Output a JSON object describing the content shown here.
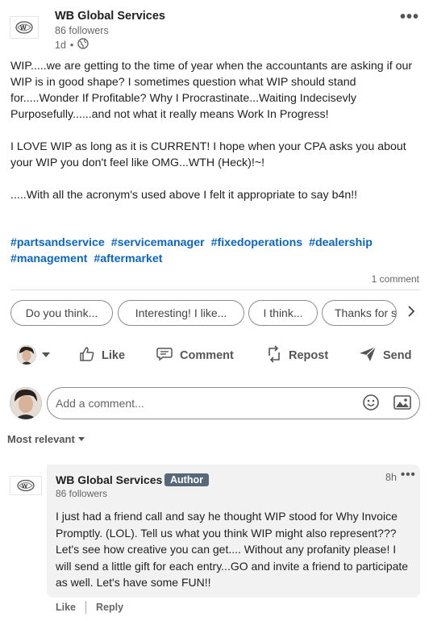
{
  "post": {
    "author": "WB Global Services",
    "followers": "86 followers",
    "time": "1d",
    "dot": "•",
    "more": "•••",
    "paragraphs": [
      "WIP.....we are getting to the time of year when the accountants are asking if our WIP is in good shape? I sometimes question what WIP should stand for.....Wonder If Profitable? Why I Procrastinate...Waiting Indecisevly Purposefully......and not what it really means Work In Progress!",
      "I LOVE WIP as long as it is CURRENT! I hope when your CPA asks you about your WIP you don't feel like OMG...WTH (Heck)!~!",
      ".....With all the acronym's used above I felt it appropriate to say b4n!!"
    ],
    "hashtags": [
      "#partsandservice",
      "#servicemanager",
      "#fixedoperations",
      "#dealership",
      "#management",
      "#aftermarket"
    ],
    "comment_count": "1 comment"
  },
  "suggestions": [
    "Do you think...",
    "Interesting! I like...",
    "I think...",
    "Thanks for s"
  ],
  "actions": {
    "like": "Like",
    "comment": "Comment",
    "repost": "Repost",
    "send": "Send"
  },
  "comment_box": {
    "placeholder": "Add a comment..."
  },
  "sort": {
    "label": "Most relevant"
  },
  "comment": {
    "author": "WB Global Services",
    "badge": "Author",
    "followers": "86 followers",
    "time": "8h",
    "more": "•••",
    "text": "I just had a friend call and say he thought WIP stood for Why Invoice Promptly. (LOL). Tell us what you think WIP might also represent??? Let's see how creative you can get.... Without any profanity please! I will send a little gift for each entry...GO and invite a friend to participate as well. Let's have some FUN!!",
    "like": "Like",
    "reply": "Reply"
  },
  "icons": {
    "globe": "globe-icon",
    "like": "thumbs-up-icon",
    "comment": "comment-icon",
    "repost": "repost-icon",
    "send": "send-icon",
    "emoji": "emoji-icon",
    "photo": "photo-icon",
    "chevron": "chevron-right-icon"
  },
  "colors": {
    "hashtag": "#0a66c2",
    "badge_bg": "#56687a",
    "bubble_bg": "#f2f2f2"
  }
}
